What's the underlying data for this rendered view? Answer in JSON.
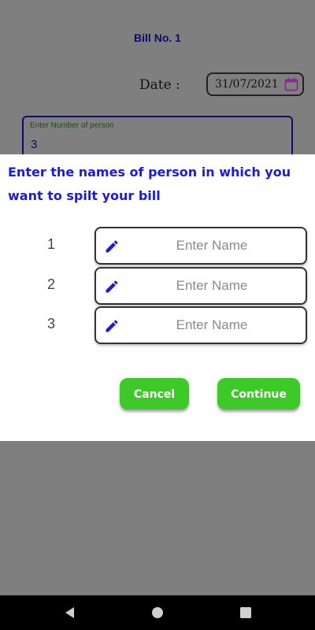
{
  "background": {
    "bill_title": "Bill No. 1",
    "date_label": "Date :",
    "date_value": "31/07/2021",
    "persons_label": "Enter Number of person",
    "persons_value": "3"
  },
  "dialog": {
    "title": "Enter the names of person in which you want to spilt your bill",
    "rows": [
      {
        "number": "1",
        "placeholder": "Enter Name",
        "value": ""
      },
      {
        "number": "2",
        "placeholder": "Enter Name",
        "value": ""
      },
      {
        "number": "3",
        "placeholder": "Enter Name",
        "value": ""
      }
    ],
    "cancel_label": "Cancel",
    "continue_label": "Continue"
  },
  "icons": {
    "edit": "pencil-icon",
    "calendar": "calendar-icon",
    "back": "back-triangle-icon",
    "home": "home-circle-icon",
    "recents": "recents-square-icon"
  },
  "colors": {
    "title_blue": "#1a1ae6",
    "button_green": "#3dc928",
    "pencil_blue": "#1a1ae6",
    "scrim": "#7f7f7f"
  }
}
